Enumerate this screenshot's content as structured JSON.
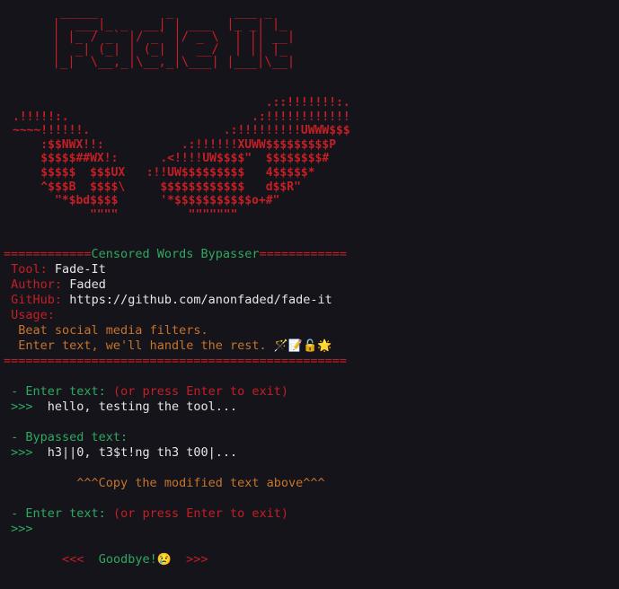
{
  "banner_art": "  _____         _        ___ _   \n |  ___|_ _  __| | ___  |_ _| |_ \n | |_ / _` |/ _` |/ _ \\  | || __|\n |  _| (_| | (_| |  __/  | || |_ \n |_|  \\__,_|\\__,_|\\___| |___|\\__|",
  "mask_art": "                                    .::!!!!!!!:.\n.!!!!!:.                          .:!!!!!!!!!!!!\n~~~~!!!!!!.                   .:!!!!!!!!!UWWW$$$\n    :$$NWX!!:           .:!!!!!!XUWW$$$$$$$$$P\n    $$$$$##WX!:      .<!!!!UW$$$$\"  $$$$$$$$#\n    $$$$$  $$$UX   :!!UW$$$$$$$$$   4$$$$$*\n    ^$$$B  $$$$\\     $$$$$$$$$$$$   d$$R\"\n      \"*$bd$$$$      '*$$$$$$$$$$$o+#\"\n           \"\"\"\"          \"\"\"\"\"\"\"",
  "header": {
    "left_rule": "============",
    "title": "Censored Words Bypasser",
    "right_rule": "============"
  },
  "info": {
    "tool_label": "Tool:",
    "tool_value": "Fade-It",
    "author_label": "Author:",
    "author_value": "Faded",
    "github_label": "GitHub:",
    "github_value": "https://github.com/anonfaded/fade-it",
    "usage_label": "Usage:",
    "usage_line1": "Beat social media filters.",
    "usage_line2": "Enter text, we'll handle the rest.",
    "usage_emojis": "🪄📝🔓🌟"
  },
  "footer_rule": "===============================================",
  "session": {
    "prompt_label": "- Enter text:",
    "prompt_hint": "(or press Enter to exit)",
    "prompt_marker": ">>>",
    "input_value": "hello, testing the tool...",
    "bypassed_label": "- Bypassed text:",
    "bypassed_value": "h3||0, t3$t!ng th3 t00|...",
    "copy_note": "^^^Copy the modified text above^^^",
    "prompt2_label": "- Enter text:",
    "prompt2_hint": "(or press Enter to exit)",
    "prompt2_marker": ">>>",
    "goodbye_left": "<<<",
    "goodbye_text": "Goodbye!",
    "goodbye_emoji": "😢",
    "goodbye_right": ">>>"
  },
  "colors": {
    "background": "#15141b",
    "red": "#c51f25",
    "green": "#2fa860",
    "orange": "#c6742b",
    "text": "#e6e6e6"
  }
}
